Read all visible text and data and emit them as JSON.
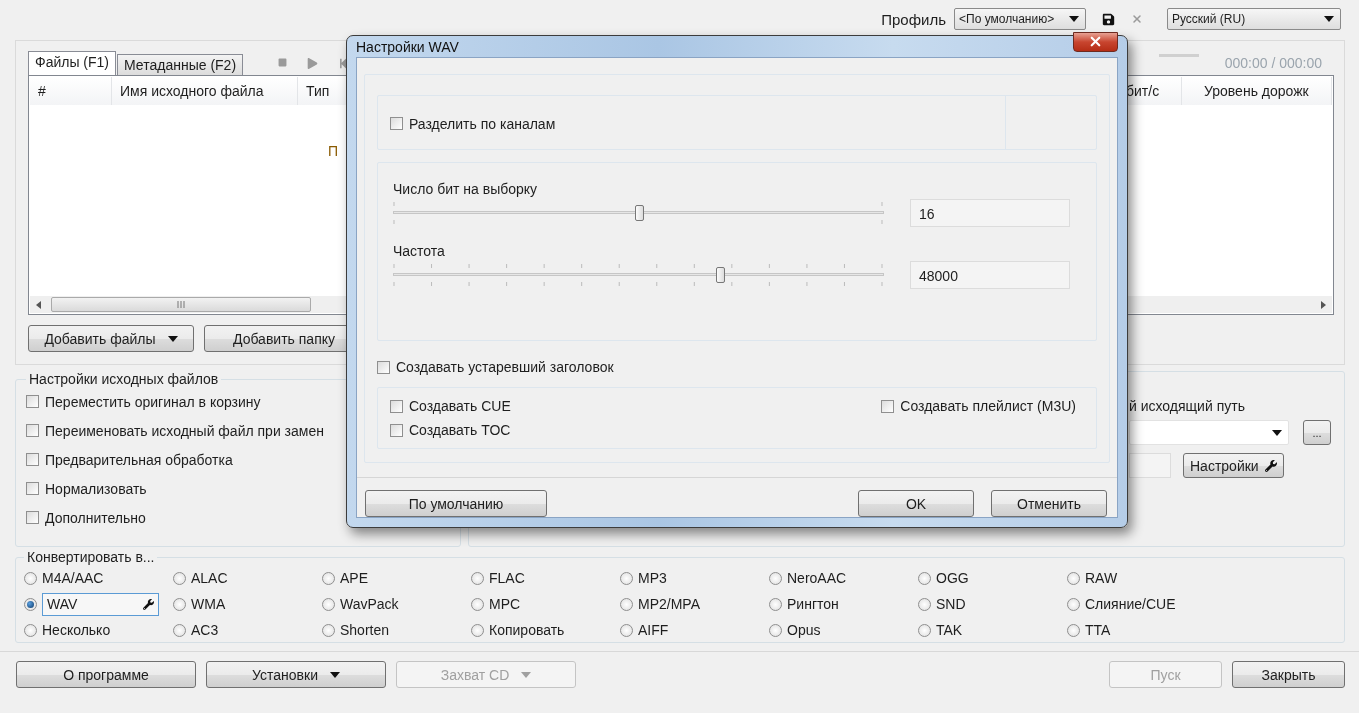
{
  "header": {
    "profile_label": "Профиль",
    "profile": "<По умолчанию>",
    "language": "Русский (RU)"
  },
  "files_panel": {
    "tabs": [
      {
        "label": "Файлы (F1)",
        "selected": true
      },
      {
        "label": "Метаданные (F2)",
        "selected": false
      }
    ],
    "time": "000:00 / 000:00",
    "table": {
      "columns_left": [
        "#",
        "Имя исходного файла",
        "Тип"
      ],
      "columns_right": [
        "бит/с",
        "Уровень дорожк"
      ],
      "empty_text": "П"
    },
    "buttons": [
      {
        "label": "Добавить файлы",
        "dropdown": true
      },
      {
        "label": "Добавить папку",
        "dropdown": false
      }
    ]
  },
  "source_settings": {
    "title": "Настройки исходных файлов",
    "options": [
      {
        "label": "Переместить оригинал в корзину",
        "checked": false
      },
      {
        "label": "Переименовать исходный файл при замен",
        "checked": false
      },
      {
        "label": "Предварительная обработка",
        "checked": false
      },
      {
        "label": "Нормализовать",
        "checked": false
      },
      {
        "label": "Дополнительно",
        "checked": false
      }
    ]
  },
  "output": {
    "path_label": "й исходящий путь",
    "browse_button": "...",
    "settings_button": "Настройки"
  },
  "convert": {
    "title": "Конвертировать в...",
    "formats": [
      {
        "label": "M4A/AAC",
        "selected": false
      },
      {
        "label": "ALAC",
        "selected": false
      },
      {
        "label": "APE",
        "selected": false
      },
      {
        "label": "FLAC",
        "selected": false
      },
      {
        "label": "MP3",
        "selected": false
      },
      {
        "label": "NeroAAC",
        "selected": false
      },
      {
        "label": "OGG",
        "selected": false
      },
      {
        "label": "RAW",
        "selected": false
      },
      {
        "label": "WAV",
        "selected": true
      },
      {
        "label": "WMA",
        "selected": false
      },
      {
        "label": "WavPack",
        "selected": false
      },
      {
        "label": "MPC",
        "selected": false
      },
      {
        "label": "MP2/MPA",
        "selected": false
      },
      {
        "label": "Рингтон",
        "selected": false
      },
      {
        "label": "SND",
        "selected": false
      },
      {
        "label": "Слияние/CUE",
        "selected": false
      },
      {
        "label": "Несколько",
        "selected": false
      },
      {
        "label": "AC3",
        "selected": false
      },
      {
        "label": "Shorten",
        "selected": false
      },
      {
        "label": "Копировать",
        "selected": false
      },
      {
        "label": "AIFF",
        "selected": false
      },
      {
        "label": "Opus",
        "selected": false
      },
      {
        "label": "TAK",
        "selected": false
      },
      {
        "label": "TTA",
        "selected": false
      }
    ]
  },
  "footer": {
    "left_buttons": [
      {
        "label": "О программе",
        "dropdown": false,
        "disabled": false
      },
      {
        "label": "Установки",
        "dropdown": true,
        "disabled": false
      },
      {
        "label": "Захват CD",
        "dropdown": true,
        "disabled": true
      }
    ],
    "right_buttons": [
      {
        "label": "Пуск",
        "dropdown": false,
        "disabled": true
      },
      {
        "label": "Закрыть",
        "dropdown": false,
        "disabled": false
      }
    ]
  },
  "dialog": {
    "title": "Настройки WAV",
    "split_channels": {
      "label": "Разделить по каналам",
      "checked": false
    },
    "sliders": [
      {
        "label": "Число бит на выборку",
        "level": 0.5,
        "value": "16",
        "kind": "ends"
      },
      {
        "label": "Частота",
        "level": 0.665,
        "value": "48000",
        "kind": "ticked"
      }
    ],
    "legacy_header": {
      "label": "Создавать устаревший заголовок",
      "checked": false
    },
    "extras": [
      {
        "label": "Создавать CUE",
        "checked": false
      },
      {
        "label": "Создавать TOC",
        "checked": false
      },
      {
        "label": "Создавать плейлист (M3U)",
        "checked": false
      }
    ],
    "buttons": [
      {
        "label": "По умолчанию"
      },
      {
        "label": "OK"
      },
      {
        "label": "Отменить"
      }
    ]
  }
}
